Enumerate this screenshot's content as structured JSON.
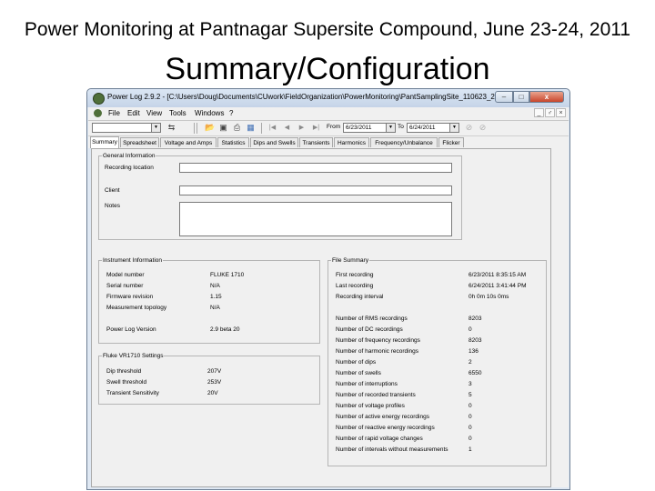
{
  "slide": {
    "title": "Power Monitoring at Pantnagar Supersite Compound, June 23-24, 2011",
    "subtitle": "Summary/Configuration"
  },
  "window": {
    "title": "Power Log 2.9.2 - [C:\\Users\\Doug\\Documents\\CUwork\\FieldOrganization\\PowerMonitoring\\PantSamplingSite_110623_24.fpq]",
    "controls": {
      "minimize": "–",
      "maximize": "□",
      "close": "x"
    }
  },
  "menu": {
    "items": [
      "File",
      "Edit",
      "View",
      "Tools",
      "Windows",
      "?"
    ],
    "mdi_controls": [
      "_",
      "♂",
      "×"
    ]
  },
  "toolbar": {
    "combo_value": "",
    "from_label": "From",
    "from_value": "6/23/2011",
    "to_label": "To",
    "to_value": "6/24/2011",
    "icons": {
      "import": "⇆",
      "open": "📂",
      "save": "▣",
      "print": "⎙",
      "export": "▦",
      "first": "|◀",
      "prev": "◀",
      "next": "▶",
      "last": "▶|",
      "zoom_in": "⊘",
      "zoom_out": "⊘"
    }
  },
  "tabs": [
    "Summary",
    "Spreadsheet",
    "Voltage and Amps",
    "Statistics",
    "Dips and Swells",
    "Transients",
    "Harmonics",
    "Frequency/Unbalance",
    "Flicker"
  ],
  "active_tab": "Summary",
  "general_info": {
    "legend": "General Information",
    "recording_location_label": "Recording location",
    "recording_location_value": "",
    "client_label": "Client",
    "client_value": "",
    "notes_label": "Notes",
    "notes_value": ""
  },
  "instrument_info": {
    "legend": "Instrument Information",
    "rows": [
      {
        "label": "Model number",
        "value": "FLUKE 1710"
      },
      {
        "label": "Serial number",
        "value": "N/A"
      },
      {
        "label": "Firmware revision",
        "value": "1.15"
      },
      {
        "label": "Measurement topology",
        "value": "N/A"
      },
      {
        "label": "Power Log Version",
        "value": "2.9 beta 20"
      }
    ]
  },
  "vr_settings": {
    "legend": "Fluke VR1710 Settings",
    "rows": [
      {
        "label": "Dip threshold",
        "value": "207V"
      },
      {
        "label": "Swell threshold",
        "value": "253V"
      },
      {
        "label": "Transient Sensitivity",
        "value": "20V"
      }
    ]
  },
  "file_summary": {
    "legend": "File Summary",
    "rows": [
      {
        "label": "First recording",
        "value": "6/23/2011 8:35:15 AM"
      },
      {
        "label": "Last recording",
        "value": "6/24/2011 3:41:44 PM"
      },
      {
        "label": "Recording interval",
        "value": "0h 0m 10s 0ms"
      },
      {
        "label": "Number of RMS recordings",
        "value": "8203"
      },
      {
        "label": "Number of DC recordings",
        "value": "0"
      },
      {
        "label": "Number of frequency recordings",
        "value": "8203"
      },
      {
        "label": "Number of harmonic recordings",
        "value": "136"
      },
      {
        "label": "Number of dips",
        "value": "2"
      },
      {
        "label": "Number of swells",
        "value": "6550"
      },
      {
        "label": "Number of interruptions",
        "value": "3"
      },
      {
        "label": "Number of recorded transients",
        "value": "5"
      },
      {
        "label": "Number of voltage profiles",
        "value": "0"
      },
      {
        "label": "Number of active energy recordings",
        "value": "0"
      },
      {
        "label": "Number of reactive energy recordings",
        "value": "0"
      },
      {
        "label": "Number of rapid voltage changes",
        "value": "0"
      },
      {
        "label": "Number of intervals without measurements",
        "value": "1"
      }
    ]
  }
}
